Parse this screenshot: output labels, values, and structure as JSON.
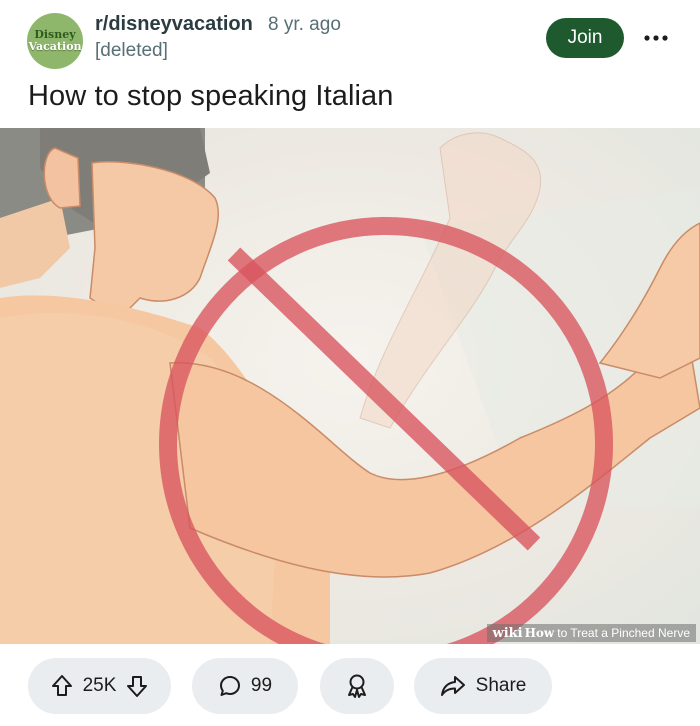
{
  "post": {
    "avatar_line1": "Disney",
    "avatar_line2": "Vacation",
    "subreddit": "r/disneyvacation",
    "age": "8 yr. ago",
    "author": "[deleted]",
    "join_label": "Join",
    "title": "How to stop speaking Italian"
  },
  "image": {
    "watermark_brand": "wiki",
    "watermark_how": "How",
    "watermark_text": "to Treat a Pinched Nerve",
    "prohibition_color": "#d9545e"
  },
  "actions": {
    "votes": "25K",
    "comments": "99",
    "share_label": "Share"
  },
  "icons": [
    "upvote-icon",
    "downvote-icon",
    "comment-icon",
    "award-icon",
    "share-icon",
    "more-options-icon"
  ]
}
